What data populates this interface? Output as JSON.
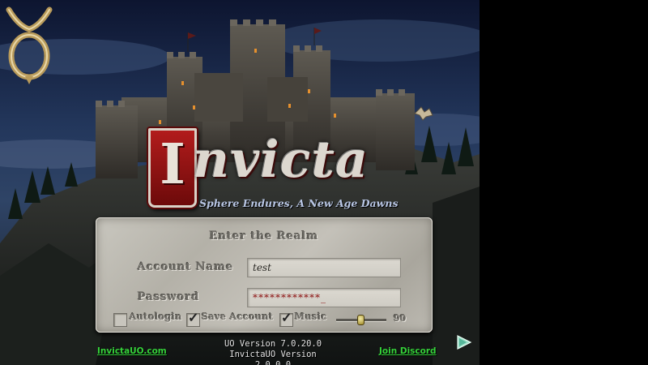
{
  "game": {
    "title_initial": "I",
    "title_rest": "nvicta",
    "tagline": "Sphere Endures, A New Age Dawns"
  },
  "login": {
    "heading": "Enter the Realm",
    "account_label": "Account Name",
    "account_value": "test",
    "password_label": "Password",
    "password_value": "************_",
    "options": [
      {
        "label": "Autologin",
        "checked": false
      },
      {
        "label": "Save Account",
        "checked": true
      },
      {
        "label": "Music",
        "checked": true
      }
    ],
    "music_volume": 90,
    "music_volume_label": "90"
  },
  "footer": {
    "website_link": "InvictaUO.com",
    "discord_link": "Join  Discord",
    "version_line1": "UO Version 7.0.20.0",
    "version_line2": "InvictaUO Version 2.0.0.0"
  },
  "icons": {
    "emblem": "ultima-ankh-emblem-icon",
    "next": "next-arrow-icon",
    "gargoyle": "gargoyle-figure-icon"
  },
  "colors": {
    "link_green": "#35d23a",
    "title_red": "#b21c1c",
    "tagline_blue": "#b8c6e4"
  }
}
